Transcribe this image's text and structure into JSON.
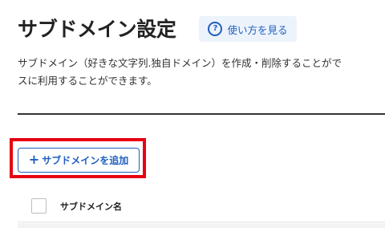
{
  "header": {
    "title": "サブドメイン設定",
    "help_label": "使い方を見る",
    "help_icon": "question-circle-icon"
  },
  "description": {
    "line1": "サブドメイン（好きな文字列.独自ドメイン）を作成・削除することがで",
    "line2": "スに利用することができます。"
  },
  "actions": {
    "add_label": "サブドメインを追加",
    "add_icon": "plus-icon"
  },
  "table": {
    "columns": [
      "サブドメイン名"
    ]
  },
  "colors": {
    "accent": "#1f5fbf",
    "highlight": "#e60012"
  }
}
